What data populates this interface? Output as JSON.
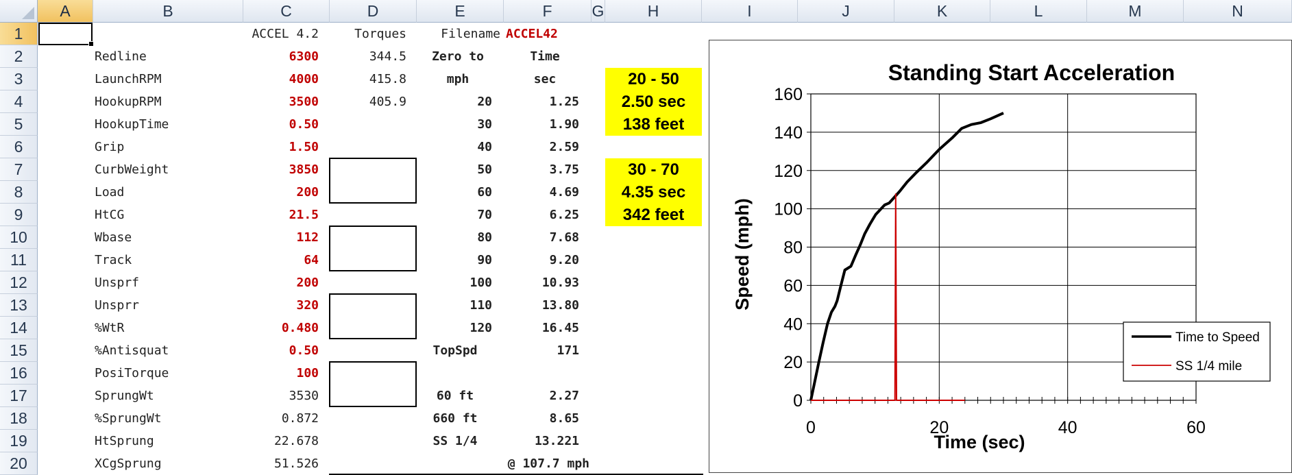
{
  "columns": [
    "A",
    "B",
    "C",
    "D",
    "E",
    "F",
    "G",
    "H",
    "I",
    "J",
    "K",
    "L",
    "M",
    "N"
  ],
  "rows": [
    "1",
    "2",
    "3",
    "4",
    "5",
    "6",
    "7",
    "8",
    "9",
    "10",
    "11",
    "12",
    "13",
    "14",
    "15",
    "16",
    "17",
    "18",
    "19",
    "20"
  ],
  "header_row": {
    "c_title": "ACCEL 4.2",
    "d_title": "Torques",
    "e_label": "Filename",
    "f_value": "ACCEL42"
  },
  "params": [
    {
      "label": "Redline",
      "value": "6300",
      "torque": "344.5"
    },
    {
      "label": "LaunchRPM",
      "value": "4000",
      "torque": "415.8"
    },
    {
      "label": "HookupRPM",
      "value": "3500",
      "torque": "405.9"
    },
    {
      "label": "HookupTime",
      "value": "0.50"
    },
    {
      "label": "Grip",
      "value": "1.50"
    },
    {
      "label": "CurbWeight",
      "value": "3850"
    },
    {
      "label": "Load",
      "value": "200"
    },
    {
      "label": "HtCG",
      "value": "21.5"
    },
    {
      "label": "Wbase",
      "value": "112"
    },
    {
      "label": "Track",
      "value": "64"
    },
    {
      "label": "Unsprf",
      "value": "200"
    },
    {
      "label": "Unsprr",
      "value": "320"
    },
    {
      "label": "%WtR",
      "value": "0.480"
    },
    {
      "label": "%Antisquat",
      "value": "0.50"
    },
    {
      "label": "PosiTorque",
      "value": "100"
    },
    {
      "label": "SprungWt",
      "value": "3530"
    },
    {
      "label": "%SprungWt",
      "value": "0.872"
    },
    {
      "label": "HtSprung",
      "value": "22.678"
    },
    {
      "label": "XCgSprung",
      "value": "51.526"
    }
  ],
  "speed_table": {
    "header1": [
      "Zero to",
      "Time"
    ],
    "header2": [
      "mph",
      "sec"
    ],
    "rows": [
      [
        "20",
        "1.25"
      ],
      [
        "30",
        "1.90"
      ],
      [
        "40",
        "2.59"
      ],
      [
        "50",
        "3.75"
      ],
      [
        "60",
        "4.69"
      ],
      [
        "70",
        "6.25"
      ],
      [
        "80",
        "7.68"
      ],
      [
        "90",
        "9.20"
      ],
      [
        "100",
        "10.93"
      ],
      [
        "110",
        "13.80"
      ],
      [
        "120",
        "16.45"
      ]
    ],
    "topspd_label": "TopSpd",
    "topspd_value": "171"
  },
  "distance_table": [
    [
      "60 ft",
      "2.27"
    ],
    [
      "660 ft",
      "8.65"
    ],
    [
      "SS 1/4",
      "13.221"
    ]
  ],
  "trap_speed": "@ 107.7 mph",
  "yellow_boxes": [
    [
      "20 - 50",
      "2.50  sec",
      "138  feet"
    ],
    [
      "30 - 70",
      "4.35  sec",
      "342  feet"
    ]
  ],
  "chart_data": {
    "type": "line",
    "title": "Standing Start Acceleration",
    "xlabel": "Time (sec)",
    "ylabel": "Speed (mph)",
    "xlim": [
      0,
      60
    ],
    "ylim": [
      0,
      160
    ],
    "xticks": [
      0,
      20,
      40,
      60
    ],
    "yticks": [
      0,
      20,
      40,
      60,
      80,
      100,
      120,
      140,
      160
    ],
    "grid": true,
    "legend_position": "lower-right",
    "series": [
      {
        "name": "Time to Speed",
        "color": "#000000",
        "x": [
          0,
          0.5,
          1.25,
          1.9,
          2.59,
          3.2,
          3.75,
          4.1,
          4.69,
          5.3,
          6.25,
          7.0,
          7.68,
          8.4,
          9.2,
          10.1,
          10.93,
          11.5,
          12.2,
          13.8,
          15.0,
          16.45,
          18.0,
          20.0,
          22.0,
          23.5,
          25.0,
          26.5,
          28.0,
          30.0
        ],
        "y": [
          0,
          8,
          20,
          30,
          40,
          46,
          49,
          52,
          60,
          68,
          70,
          76,
          81,
          87,
          92,
          97,
          100,
          102,
          103,
          109,
          114,
          119,
          124,
          131,
          137,
          142,
          144,
          145,
          147,
          150
        ]
      },
      {
        "name": "SS 1/4 mile",
        "color": "#cc0000",
        "x": [
          0,
          13.1,
          13.221,
          13.35,
          24
        ],
        "y": [
          0,
          0,
          107.7,
          0,
          0
        ]
      }
    ]
  }
}
